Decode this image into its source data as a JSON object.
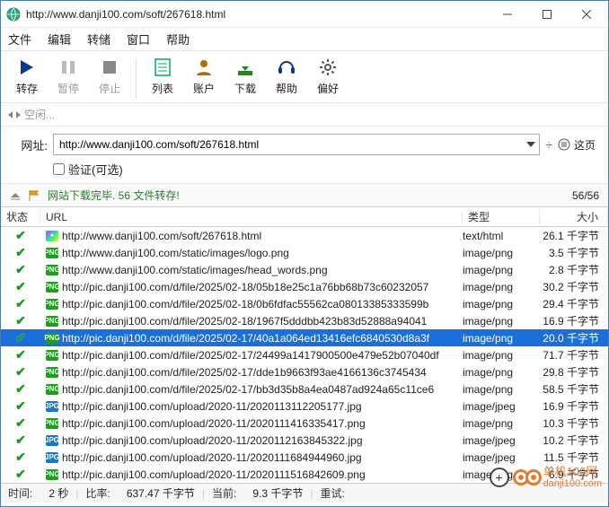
{
  "window": {
    "title": "http://www.danji100.com/soft/267618.html"
  },
  "menu": {
    "file": "文件",
    "edit": "编辑",
    "transfer": "转储",
    "window": "窗口",
    "help": "帮助"
  },
  "toolbar": {
    "start": "转存",
    "pause": "暂停",
    "stop": "停止",
    "list": "列表",
    "account": "账户",
    "download": "下载",
    "support": "帮助",
    "prefs": "偏好"
  },
  "idle": {
    "label": "空闲..."
  },
  "form": {
    "url_label": "网址:",
    "url_value": "http://www.danji100.com/soft/267618.html",
    "this_page": "这页",
    "verify": "验证(可选)"
  },
  "status": {
    "text": "网站下载完毕. 56 文件转存!",
    "count": "56/56"
  },
  "columns": {
    "status": "状态",
    "url": "URL",
    "type": "类型",
    "size": "大小"
  },
  "rows": [
    {
      "icon": "html",
      "url": "http://www.danji100.com/soft/267618.html",
      "type": "text/html",
      "size": "26.1 千字节"
    },
    {
      "icon": "png",
      "url": "http://www.danji100.com/static/images/logo.png",
      "type": "image/png",
      "size": "3.5 千字节"
    },
    {
      "icon": "png",
      "url": "http://www.danji100.com/static/images/head_words.png",
      "type": "image/png",
      "size": "2.8 千字节"
    },
    {
      "icon": "png",
      "url": "http://pic.danji100.com/d/file/2025/02-18/05b18e25c1a76bb68b73c60232057",
      "type": "image/png",
      "size": "30.2 千字节"
    },
    {
      "icon": "png",
      "url": "http://pic.danji100.com/d/file/2025/02-18/0b6fdfac55562ca08013385333599b",
      "type": "image/png",
      "size": "29.4 千字节"
    },
    {
      "icon": "png",
      "url": "http://pic.danji100.com/d/file/2025/02-18/1967f5dddbb423b83d52888a94041",
      "type": "image/png",
      "size": "16.9 千字节"
    },
    {
      "icon": "png",
      "url": "http://pic.danji100.com/d/file/2025/02-17/40a1a064ed13416efc6840530d8a3f",
      "type": "image/png",
      "size": "20.0 千字节",
      "selected": true
    },
    {
      "icon": "png",
      "url": "http://pic.danji100.com/d/file/2025/02-17/24499a1417900500e479e52b07040df",
      "type": "image/png",
      "size": "71.7 千字节"
    },
    {
      "icon": "png",
      "url": "http://pic.danji100.com/d/file/2025/02-17/dde1b9663f93ae4166136c3745434",
      "type": "image/png",
      "size": "29.8 千字节"
    },
    {
      "icon": "png",
      "url": "http://pic.danji100.com/d/file/2025/02-17/bb3d35b8a4ea0487ad924a65c11ce6",
      "type": "image/png",
      "size": "58.5 千字节"
    },
    {
      "icon": "jpg",
      "url": "http://pic.danji100.com/upload/2020-11/2020113112205177.jpg",
      "type": "image/jpeg",
      "size": "16.9 千字节"
    },
    {
      "icon": "png",
      "url": "http://pic.danji100.com/upload/2020-11/2020111416335417.png",
      "type": "image/png",
      "size": "10.3 千字节"
    },
    {
      "icon": "jpg",
      "url": "http://pic.danji100.com/upload/2020-11/2020112163845322.jpg",
      "type": "image/jpeg",
      "size": "10.2 千字节"
    },
    {
      "icon": "jpg",
      "url": "http://pic.danji100.com/upload/2020-11/2020111684944960.jpg",
      "type": "image/jpeg",
      "size": "11.5 千字节"
    },
    {
      "icon": "png",
      "url": "http://pic.danji100.com/upload/2020-11/2020111516842609.png",
      "type": "image/png",
      "size": "6.9 千字节"
    }
  ],
  "footer": {
    "time_l": "时间:",
    "time_v": "2 秒",
    "rate_l": "比率:",
    "rate_v": "637.47 千字节",
    "cur_l": "当前:",
    "cur_v": "9.3 千字节",
    "retry_l": "重试:"
  },
  "watermark": {
    "site": "单机100网",
    "url": "danji100.com"
  }
}
